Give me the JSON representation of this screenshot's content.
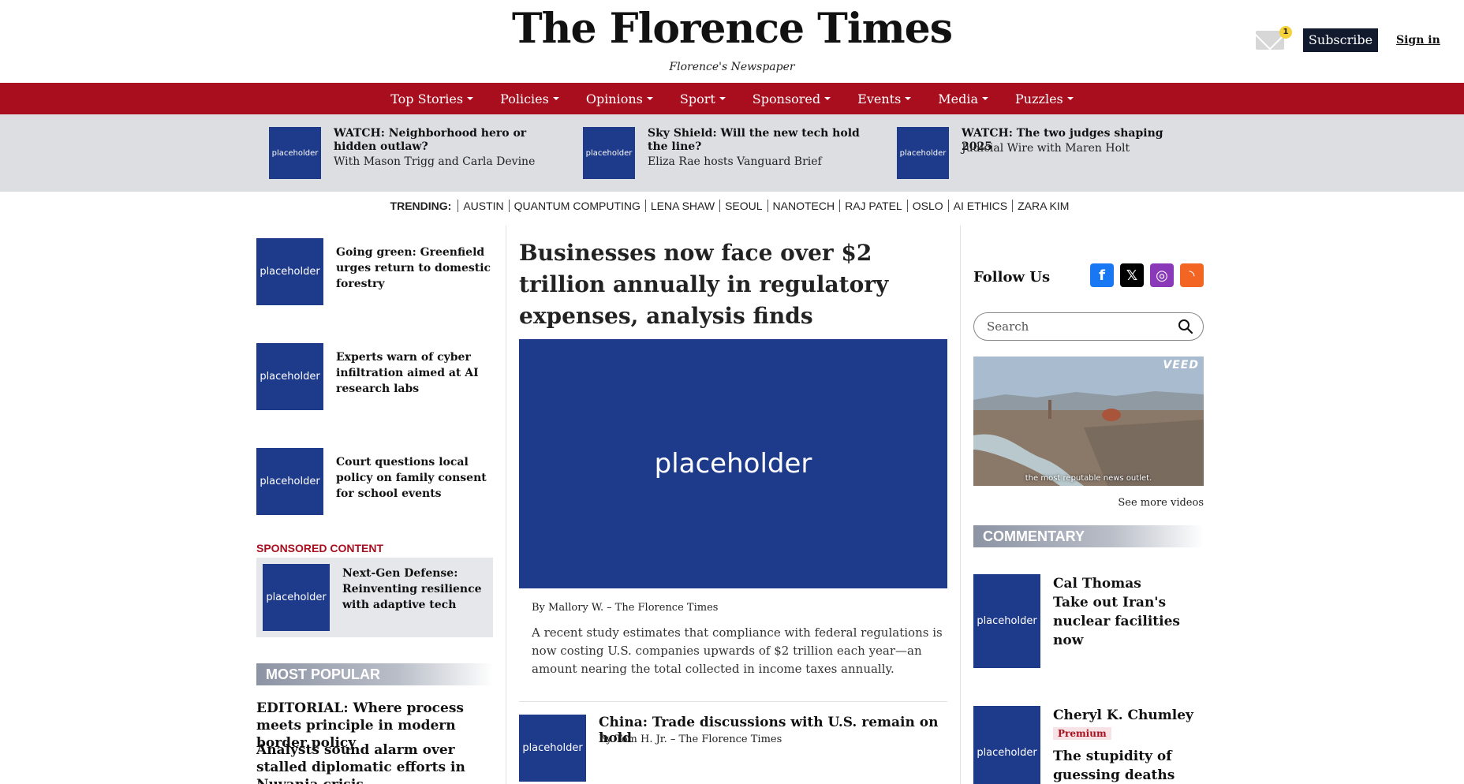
{
  "masthead": {
    "logo": "The Florence Times",
    "tagline": "Florence's Newspaper",
    "mail_badge": "1",
    "subscribe": "Subscribe",
    "signin": "Sign in"
  },
  "nav": [
    "Top Stories",
    "Policies",
    "Opinions",
    "Sport",
    "Sponsored",
    "Events",
    "Media",
    "Puzzles"
  ],
  "videos": [
    {
      "thumb": "placeholder",
      "title": "WATCH: Neighborhood hero or hidden outlaw?",
      "sub": "With Mason Trigg and Carla Devine"
    },
    {
      "thumb": "placeholder",
      "title": "Sky Shield: Will the new tech hold the line?",
      "sub": "Eliza Rae hosts Vanguard Brief"
    },
    {
      "thumb": "placeholder",
      "title": "WATCH: The two judges shaping 2025",
      "sub": "Judicial Wire with Maren Holt"
    }
  ],
  "trending": {
    "label": "TRENDING:",
    "items": [
      "AUSTIN",
      "QUANTUM COMPUTING",
      "LENA SHAW",
      "SEOUL",
      "NANOTECH",
      "RAJ PATEL",
      "OSLO",
      "AI ETHICS",
      "ZARA KIM"
    ]
  },
  "left": {
    "stories": [
      {
        "thumb": "placeholder",
        "title": "Going green: Greenfield urges return to domestic forestry"
      },
      {
        "thumb": "placeholder",
        "title": "Experts warn of cyber infiltration aimed at AI research labs"
      },
      {
        "thumb": "placeholder",
        "title": "Court questions local policy on family consent for school events"
      }
    ],
    "sponsored_label": "SPONSORED CONTENT",
    "sponsored": {
      "thumb": "placeholder",
      "title": "Next-Gen Defense: Reinventing resilience with adaptive tech"
    },
    "popular_header": "MOST POPULAR",
    "popular": [
      "EDITORIAL: Where process meets principle in modern border policy",
      "Analysts sound alarm over stalled diplomatic efforts in Nuvania crisis"
    ]
  },
  "main": {
    "headline": "Businesses now face over $2 trillion annually in regulatory expenses, analysis finds",
    "image": "placeholder",
    "byline_author": "By Mallory W.",
    "byline_sep": "–",
    "byline_outlet": "The Florence Times",
    "summary": "A recent study estimates that compliance with federal regulations is now costing U.S. companies upwards of $2 trillion each year—an amount nearing the total collected in income taxes annually.",
    "sub_story": {
      "thumb": "placeholder",
      "title": "China: Trade discussions with U.S. remain on hold",
      "byline": "By Tom H. Jr. – The Florence Times"
    }
  },
  "right": {
    "follow": "Follow Us",
    "social": [
      {
        "icon": "facebook-icon",
        "glyph": "f",
        "color": "#1877f2"
      },
      {
        "icon": "x-icon",
        "glyph": "𝕏",
        "color": "#000000"
      },
      {
        "icon": "instagram-icon",
        "glyph": "◎",
        "color": "#8a3ab9"
      },
      {
        "icon": "rss-icon",
        "glyph": "◝",
        "color": "#f26522"
      }
    ],
    "search_placeholder": "Search",
    "video_brand": "VEED",
    "video_caption": "the most reputable news outlet.",
    "see_more": "See more videos",
    "commentary_header": "COMMENTARY",
    "commentary": [
      {
        "thumb": "placeholder",
        "author": "Cal Thomas",
        "title": "Take out Iran's nuclear facilities now"
      },
      {
        "thumb": "placeholder",
        "author": "Cheryl K. Chumley",
        "badge": "Premium",
        "title": "The stupidity of guessing deaths"
      }
    ]
  },
  "colors": {
    "brand_red": "#a80e1e",
    "navy": "#1e3a8a",
    "subscribe_bg": "#121a2e",
    "strip_bg": "#dcdee2"
  }
}
